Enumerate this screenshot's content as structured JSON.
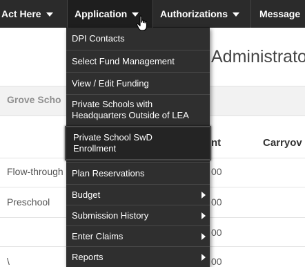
{
  "navbar": {
    "items": [
      {
        "label": "Act Here"
      },
      {
        "label": "Application"
      },
      {
        "label": "Authorizations"
      },
      {
        "label": "Message"
      }
    ]
  },
  "page": {
    "heading": "Administrator",
    "school_name": "Grove Scho",
    "columns": {
      "amount": "nt",
      "carryover": "Carryov"
    },
    "rows": [
      {
        "label": "Flow-through",
        "amount": "00"
      },
      {
        "label": "Preschool",
        "amount": "00"
      },
      {
        "label": "",
        "amount": "00"
      },
      {
        "label": "\\",
        "amount": "00"
      }
    ]
  },
  "dropdown": {
    "items": [
      {
        "label": "DPI Contacts"
      },
      {
        "label": "Select Fund Management"
      },
      {
        "label": "View / Edit Funding"
      },
      {
        "label": "Private Schools with Headquarters Outside of LEA"
      },
      {
        "label": "Private School SwD Enrollment"
      },
      {
        "label": "Plan Reservations"
      },
      {
        "label": "Budget"
      },
      {
        "label": "Submission History"
      },
      {
        "label": "Enter Claims"
      },
      {
        "label": "Reports"
      }
    ]
  },
  "colors": {
    "navbar_bg": "#2b2b2b",
    "menu_bg": "#2f2f2f",
    "highlight_bg": "#242424",
    "band_bg": "#f2f2f2"
  },
  "icons": {
    "cursor": "hand-pointer-icon"
  }
}
